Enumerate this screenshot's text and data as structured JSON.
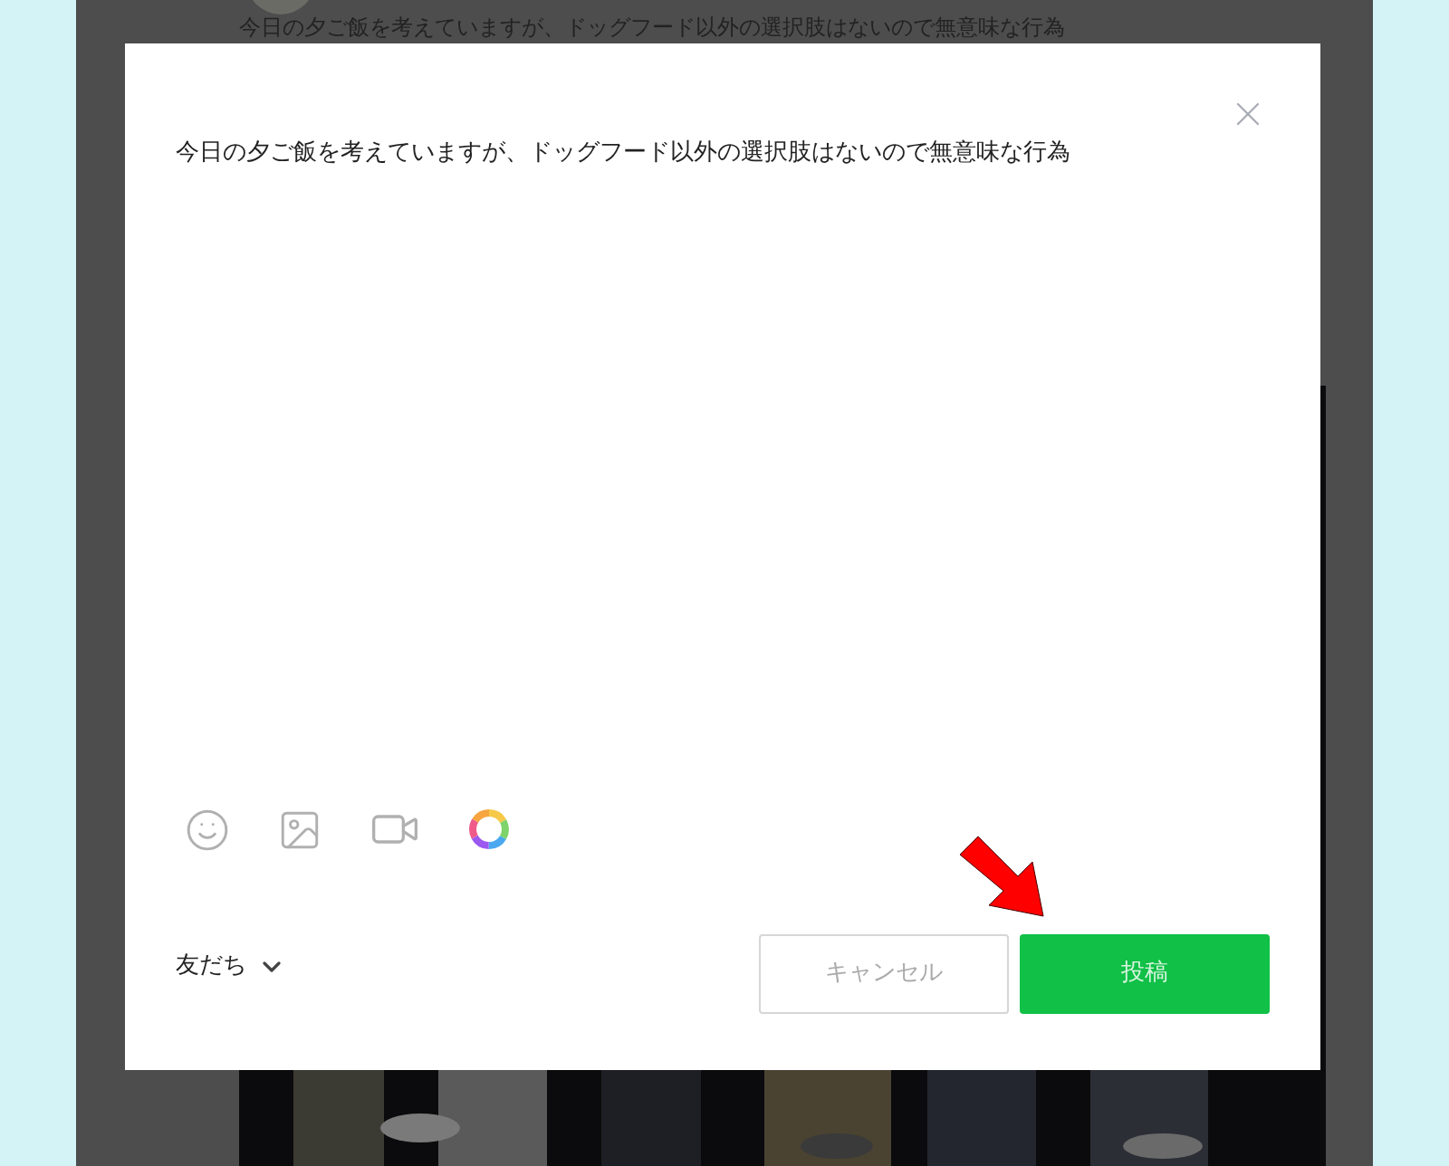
{
  "background_post": {
    "text": "今日の夕ご飯を考えていますが、ドッグフード以外の選択肢はないので無意味な行為"
  },
  "composer": {
    "text": "今日の夕ご飯を考えていますが、ドッグフード以外の選択肢はないので無意味な行為",
    "audience": "友だち",
    "buttons": [
      {
        "label": "キャンセル",
        "kind": "cancel"
      },
      {
        "label": "投稿",
        "kind": "post"
      }
    ]
  }
}
